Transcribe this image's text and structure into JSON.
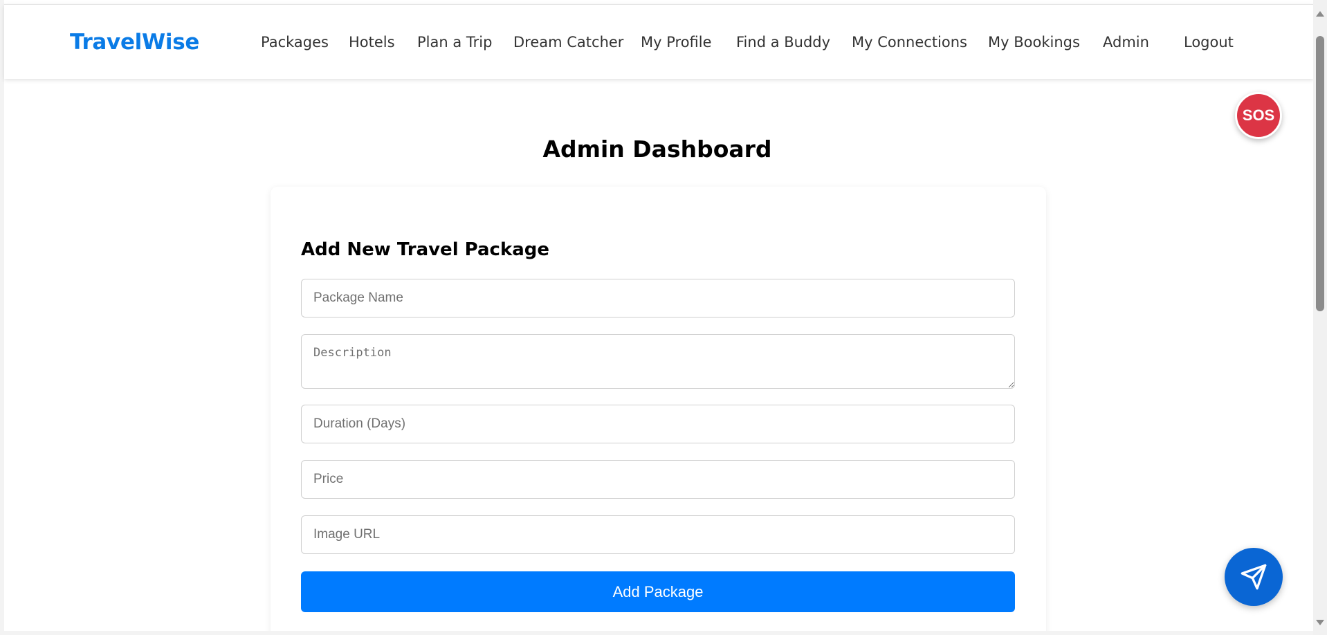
{
  "navbar": {
    "brand": "TravelWise",
    "links": [
      {
        "label": "Packages"
      },
      {
        "label": "Hotels"
      },
      {
        "label": "Plan a Trip"
      },
      {
        "label": "Dream Catcher"
      },
      {
        "label": "My Profile"
      },
      {
        "label": "Find a Buddy"
      },
      {
        "label": "My Connections"
      },
      {
        "label": "My Bookings"
      },
      {
        "label": "Admin"
      },
      {
        "label": "Logout"
      }
    ]
  },
  "sos": {
    "label": "SOS",
    "color": "#dc3545"
  },
  "page": {
    "title": "Admin Dashboard"
  },
  "form": {
    "title": "Add New Travel Package",
    "fields": {
      "package_name": {
        "placeholder": "Package Name",
        "value": ""
      },
      "description": {
        "placeholder": "Description",
        "value": ""
      },
      "duration": {
        "placeholder": "Duration (Days)",
        "value": ""
      },
      "price": {
        "placeholder": "Price",
        "value": ""
      },
      "image_url": {
        "placeholder": "Image URL",
        "value": ""
      }
    },
    "submit_label": "Add Package"
  },
  "chat": {
    "icon": "paper-plane-icon"
  },
  "colors": {
    "brand": "#0a7be6",
    "primary_button": "#007bff",
    "chat_button": "#0a66d4"
  }
}
